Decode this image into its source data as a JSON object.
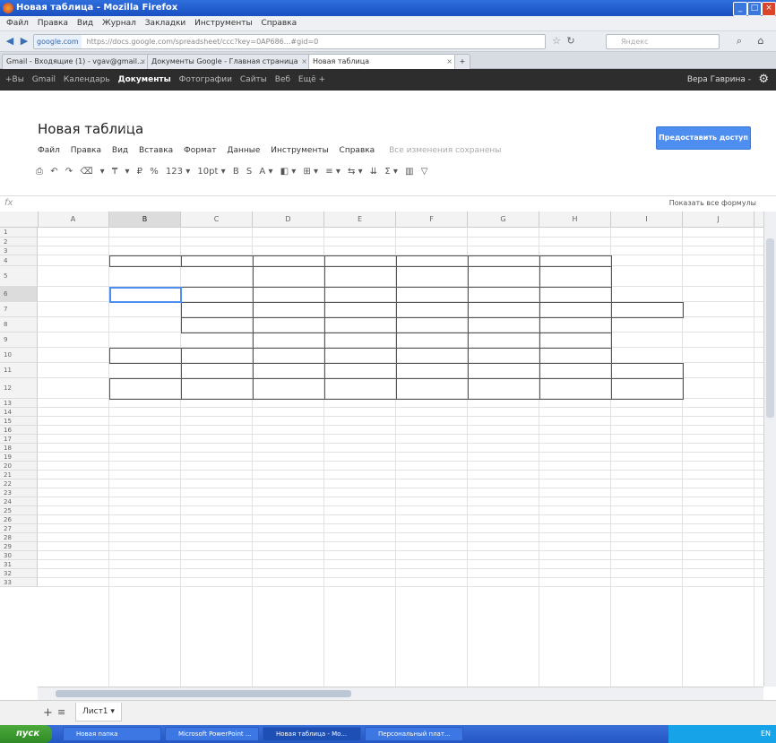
{
  "window": {
    "title": "Новая таблица - Mozilla Firefox",
    "min": "_",
    "max": "□",
    "close": "×"
  },
  "menubar": [
    "Файл",
    "Правка",
    "Вид",
    "Журнал",
    "Закладки",
    "Инструменты",
    "Справка"
  ],
  "navbar": {
    "site": "google.com",
    "url": "https://docs.google.com/spreadsheet/ccc?key=0AP686...#gid=0",
    "search_placeholder": "Яндекс"
  },
  "tabs": [
    {
      "label": "Gmail - Входящие (1) - vgav@gmail..."
    },
    {
      "label": "Документы Google - Главная страница"
    },
    {
      "label": "Новая таблица"
    }
  ],
  "gbar": {
    "items": [
      "+Вы",
      "Gmail",
      "Календарь",
      "Документы",
      "Фотографии",
      "Сайты",
      "Веб",
      "Ещё +"
    ],
    "active_index": 3,
    "user": "Вера Гаврина -"
  },
  "doc": {
    "title": "Новая таблица",
    "menu": [
      "Файл",
      "Правка",
      "Вид",
      "Вставка",
      "Формат",
      "Данные",
      "Инструменты",
      "Справка"
    ],
    "saved_status": "Все изменения сохранены",
    "share_label": "Предоставить доступ"
  },
  "toolbar": {
    "items": [
      "⎙",
      "↶",
      "↷",
      "⌫",
      "▾",
      "₸",
      "▾",
      "₽",
      "%",
      "123 ▾",
      "10pt ▾",
      "B",
      "S",
      "A ▾",
      "◧ ▾",
      "⊞ ▾",
      "≡ ▾",
      "⇆ ▾",
      "⇊",
      "Σ ▾",
      "▥",
      "▽"
    ]
  },
  "formula_bar": {
    "fx": "fx",
    "show_all": "Показать все формулы"
  },
  "grid": {
    "columns": [
      "A",
      "B",
      "C",
      "D",
      "E",
      "F",
      "G",
      "H",
      "I",
      "J"
    ],
    "rows": [
      "1",
      "2",
      "3",
      "4",
      "5",
      "6",
      "7",
      "8",
      "9",
      "10",
      "11",
      "12",
      "13",
      "14",
      "15",
      "16",
      "17",
      "18",
      "19",
      "20",
      "21",
      "22",
      "23",
      "24",
      "25",
      "26",
      "27",
      "28",
      "29",
      "30",
      "31",
      "32",
      "33"
    ],
    "selected_cell": "B6"
  },
  "sheets": {
    "active": "Лист1 ▾"
  },
  "taskbar": {
    "start": "пуск",
    "buttons": [
      "Новая папка",
      "Microsoft PowerPoint ...",
      "Новая таблица - Мо...",
      "Персональный плат..."
    ],
    "clock": "EN"
  }
}
